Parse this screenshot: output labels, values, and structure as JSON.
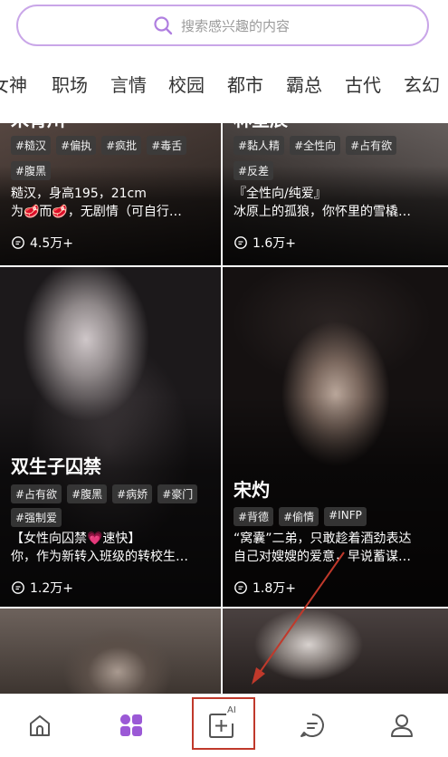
{
  "search": {
    "placeholder": "搜索感兴趣的内容"
  },
  "tabs": [
    "女神",
    "职场",
    "言情",
    "校园",
    "都市",
    "霸总",
    "古代",
    "玄幻"
  ],
  "cards": [
    {
      "title": "宋青川",
      "tags_row1": [
        "#糙汉",
        "#偏执",
        "#疯批",
        "#毒舌"
      ],
      "tags_row2": [
        "#腹黑"
      ],
      "desc1": "糙汉，身高195，21cm",
      "desc2": "为🥩而🥩，无剧情（可自行…",
      "count": "4.5万+"
    },
    {
      "title": "林星辰",
      "tags_row1": [
        "#黏人精",
        "#全性向",
        "#占有欲"
      ],
      "tags_row2": [
        "#反差"
      ],
      "desc1": "『全性向/纯爱』",
      "desc2": "冰原上的孤狼，你怀里的雪橇…",
      "count": "1.6万+"
    },
    {
      "title": "双生子囚禁",
      "tags_row1": [
        "#占有欲",
        "#腹黑",
        "#病娇",
        "#豪门"
      ],
      "tags_row2": [
        "#强制爱"
      ],
      "desc1": "【女性向囚禁💗速快】",
      "desc2": "你，作为新转入班级的转校生…",
      "count": "1.2万+"
    },
    {
      "title": "宋灼",
      "tags_row1": [
        "#背德",
        "#偷情",
        "#INFP"
      ],
      "tags_row2": [],
      "desc1": "“窝囊”二弟，只敢趁着酒劲表达",
      "desc2": "自己对嫂嫂的爱意，早说蓄谋…",
      "count": "1.8万+"
    }
  ],
  "nav": {
    "items": [
      "home",
      "discover",
      "create-ai",
      "messages",
      "profile"
    ],
    "ai_label": "AI",
    "active": "discover",
    "accent": "#9b59d6"
  },
  "colors": {
    "accent": "#9b59d6",
    "search_border": "#c9a6e8",
    "highlight_box": "#c0392b"
  }
}
